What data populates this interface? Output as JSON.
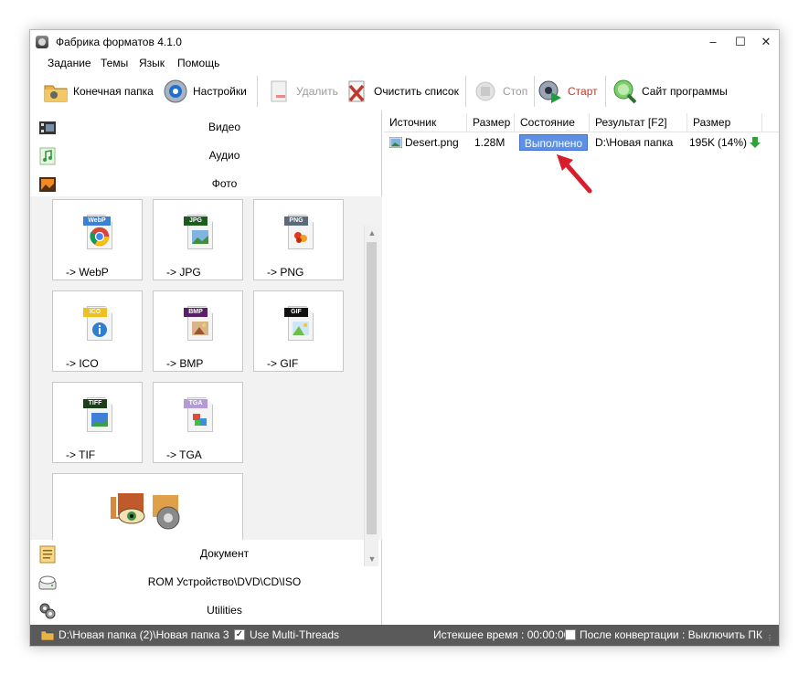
{
  "window": {
    "title": "Фабрика форматов 4.1.0"
  },
  "menu": [
    "Задание",
    "Темы",
    "Язык",
    "Помощь"
  ],
  "toolbar": {
    "output_folder": "Конечная папка",
    "settings": "Настройки",
    "delete": "Удалить",
    "clear_list": "Очистить список",
    "stop": "Стоп",
    "start": "Старт",
    "website": "Сайт программы"
  },
  "categories": {
    "video": "Видео",
    "audio": "Аудио",
    "photo": "Фото",
    "document": "Документ",
    "rom": "ROM Устройство\\DVD\\CD\\ISO",
    "utilities": "Utilities"
  },
  "formats": [
    {
      "label": "-> WebP",
      "tag": "WebP",
      "tag_color": "#3b82d6"
    },
    {
      "label": "-> JPG",
      "tag": "JPG",
      "tag_color": "#1f5a1f"
    },
    {
      "label": "-> PNG",
      "tag": "PNG",
      "tag_color": "#5a6a7a"
    },
    {
      "label": "-> ICO",
      "tag": "ICO",
      "tag_color": "#f0c020"
    },
    {
      "label": "-> BMP",
      "tag": "BMP",
      "tag_color": "#5a1f6a"
    },
    {
      "label": "-> GIF",
      "tag": "GIF",
      "tag_color": "#111111"
    },
    {
      "label": "-> TIF",
      "tag": "TIFF",
      "tag_color": "#1a3f1a"
    },
    {
      "label": "-> TGA",
      "tag": "TGA",
      "tag_color": "#b59ad8"
    }
  ],
  "table": {
    "headers": [
      "Источник",
      "Размер",
      "Состояние",
      "Результат [F2]",
      "Размер"
    ],
    "rows": [
      {
        "source": "Desert.png",
        "size": "1.28M",
        "state": "Выполнено",
        "result": "D:\\Новая папка",
        "out_size": "195K",
        "ratio": "(14%)"
      }
    ]
  },
  "status": {
    "path": "D:\\Новая папка (2)\\Новая папка 3",
    "multithread": "Use Multi-Threads",
    "elapsed": "Истекшее время : 00:00:00",
    "after_convert": "После конвертации : Выключить ПК"
  },
  "colors": {
    "accent": "#5d8fe5",
    "statusbar": "#5a5a5a",
    "start_text": "#c0392b",
    "arrow": "#d81e2c"
  }
}
